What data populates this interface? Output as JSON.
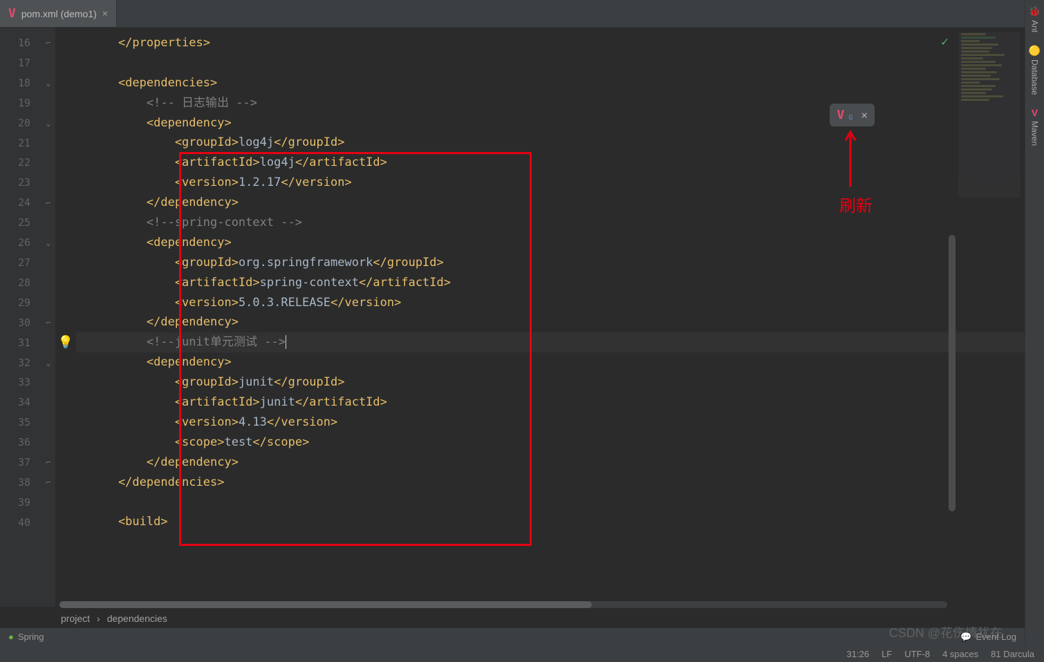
{
  "tab": {
    "icon": "V",
    "label": "pom.xml (demo1)",
    "close": "×"
  },
  "lines": {
    "start": 16,
    "items": [
      {
        "n": 16,
        "fold": "⌐",
        "html": [
          [
            "t-tag",
            "    </properties>"
          ]
        ]
      },
      {
        "n": 17,
        "fold": "",
        "html": [
          [
            "",
            "    "
          ]
        ]
      },
      {
        "n": 18,
        "fold": "⌄",
        "html": [
          [
            "t-tag",
            "    <dependencies>"
          ]
        ]
      },
      {
        "n": 19,
        "fold": "",
        "html": [
          [
            "t-comment",
            "        <!-- 日志输出 -->"
          ]
        ]
      },
      {
        "n": 20,
        "fold": "⌄",
        "html": [
          [
            "t-tag",
            "        <dependency>"
          ]
        ]
      },
      {
        "n": 21,
        "fold": "",
        "html": [
          [
            "t-tag",
            "            <groupId>"
          ],
          [
            "t-txt",
            "log4j"
          ],
          [
            "t-tag",
            "</groupId>"
          ]
        ]
      },
      {
        "n": 22,
        "fold": "",
        "html": [
          [
            "t-tag",
            "            <artifactId>"
          ],
          [
            "t-txt",
            "log4j"
          ],
          [
            "t-tag",
            "</artifactId>"
          ]
        ]
      },
      {
        "n": 23,
        "fold": "",
        "html": [
          [
            "t-tag",
            "            <version>"
          ],
          [
            "t-txt",
            "1.2.17"
          ],
          [
            "t-tag",
            "</version>"
          ]
        ]
      },
      {
        "n": 24,
        "fold": "⌐",
        "html": [
          [
            "t-tag",
            "        </dependency>"
          ]
        ]
      },
      {
        "n": 25,
        "fold": "",
        "html": [
          [
            "t-comment",
            "        <!--spring-context -->"
          ]
        ]
      },
      {
        "n": 26,
        "fold": "⌄",
        "html": [
          [
            "t-tag",
            "        <dependency>"
          ]
        ]
      },
      {
        "n": 27,
        "fold": "",
        "html": [
          [
            "t-tag",
            "            <groupId>"
          ],
          [
            "t-txt",
            "org.springframework"
          ],
          [
            "t-tag",
            "</groupId>"
          ]
        ]
      },
      {
        "n": 28,
        "fold": "",
        "html": [
          [
            "t-tag",
            "            <artifactId>"
          ],
          [
            "t-txt",
            "spring-context"
          ],
          [
            "t-tag",
            "</artifactId>"
          ]
        ]
      },
      {
        "n": 29,
        "fold": "",
        "html": [
          [
            "t-tag",
            "            <version>"
          ],
          [
            "t-txt",
            "5.0.3.RELEASE"
          ],
          [
            "t-tag",
            "</version>"
          ]
        ]
      },
      {
        "n": 30,
        "fold": "⌐",
        "html": [
          [
            "t-tag",
            "        </dependency>"
          ]
        ]
      },
      {
        "n": 31,
        "fold": "",
        "bulb": true,
        "current": true,
        "html": [
          [
            "t-comment",
            "        <!--junit单元测试 -->"
          ],
          [
            "caret",
            ""
          ]
        ]
      },
      {
        "n": 32,
        "fold": "⌄",
        "html": [
          [
            "t-tag",
            "        <dependency>"
          ]
        ]
      },
      {
        "n": 33,
        "fold": "",
        "html": [
          [
            "t-tag",
            "            <groupId>"
          ],
          [
            "t-txt",
            "junit"
          ],
          [
            "t-tag",
            "</groupId>"
          ]
        ]
      },
      {
        "n": 34,
        "fold": "",
        "html": [
          [
            "t-tag",
            "            <artifactId>"
          ],
          [
            "t-txt",
            "junit"
          ],
          [
            "t-tag",
            "</artifactId>"
          ]
        ]
      },
      {
        "n": 35,
        "fold": "",
        "html": [
          [
            "t-tag",
            "            <version>"
          ],
          [
            "t-txt",
            "4.13"
          ],
          [
            "t-tag",
            "</version>"
          ]
        ]
      },
      {
        "n": 36,
        "fold": "",
        "html": [
          [
            "t-tag",
            "            <scope>"
          ],
          [
            "t-txt",
            "test"
          ],
          [
            "t-tag",
            "</scope>"
          ]
        ]
      },
      {
        "n": 37,
        "fold": "⌐",
        "html": [
          [
            "t-tag",
            "        </dependency>"
          ]
        ]
      },
      {
        "n": 38,
        "fold": "⌐",
        "html": [
          [
            "t-tag",
            "    </dependencies>"
          ]
        ]
      },
      {
        "n": 39,
        "fold": "",
        "html": [
          [
            "",
            ""
          ]
        ]
      },
      {
        "n": 40,
        "fold": "",
        "html": [
          [
            "t-tag",
            "    <build>"
          ]
        ]
      }
    ]
  },
  "breadcrumb": {
    "a": "project",
    "sep": "›",
    "b": "dependencies"
  },
  "float": {
    "icon": "V",
    "sub": "G",
    "close": "×"
  },
  "annotation": {
    "arrow": "↑",
    "label": "刷新"
  },
  "sidebar": {
    "ant": {
      "glyph": "🐞",
      "label": "Ant"
    },
    "db": {
      "glyph": "🟡",
      "label": "Database"
    },
    "maven": {
      "glyph": "V",
      "label": "Maven"
    }
  },
  "footer": {
    "spring_glyph": "●",
    "spring": "Spring",
    "eventlog_glyph": "💬",
    "eventlog": "Event Log"
  },
  "status": {
    "pos": "31:26",
    "lf": "LF",
    "enc": "UTF-8",
    "spaces": "4 spaces",
    "theme": "81 Darcula"
  },
  "watermark": "CSDN @花伤情犹在",
  "check": "✓"
}
